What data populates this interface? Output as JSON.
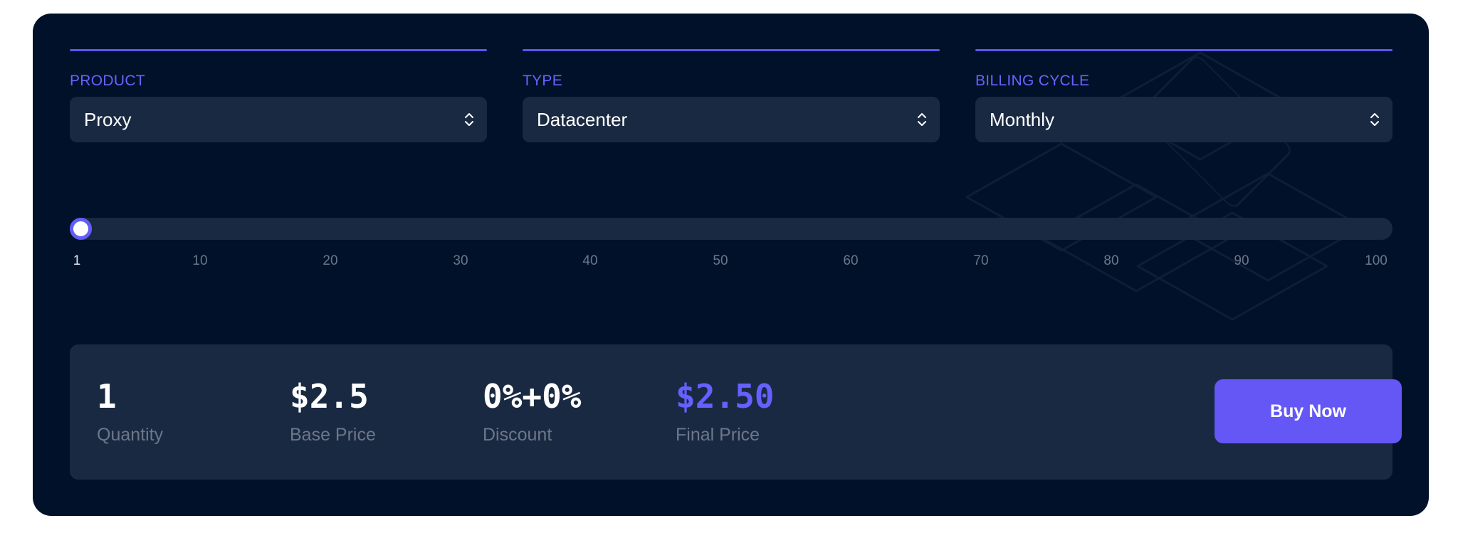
{
  "fields": [
    {
      "label": "PRODUCT",
      "value": "Proxy"
    },
    {
      "label": "TYPE",
      "value": "Datacenter"
    },
    {
      "label": "BILLING CYCLE",
      "value": "Monthly"
    }
  ],
  "slider": {
    "value": 1,
    "min": 1,
    "max": 100,
    "ticks": [
      "1",
      "10",
      "20",
      "30",
      "40",
      "50",
      "60",
      "70",
      "80",
      "90",
      "100"
    ]
  },
  "summary": {
    "quantity": {
      "value": "1",
      "caption": "Quantity"
    },
    "base_price": {
      "value": "$2.5",
      "caption": "Base Price"
    },
    "discount": {
      "value": "0%+0%",
      "caption": "Discount"
    },
    "final_price": {
      "value": "$2.50",
      "caption": "Final Price"
    },
    "buy_label": "Buy Now"
  },
  "colors": {
    "background": "#01112a",
    "panel": "#1a2942",
    "accent": "#6457f6",
    "label": "#6863ff"
  },
  "icons": {
    "select_indicator": "chevron-up-down-icon"
  }
}
